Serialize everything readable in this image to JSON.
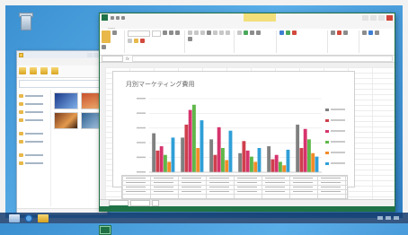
{
  "desktop": {
    "icons": [
      {
        "icon": "recycle-bin-icon"
      }
    ]
  },
  "explorer": {
    "tabs": [
      {
        "label": ""
      },
      {
        "label": ""
      },
      {
        "label": ""
      },
      {
        "label": ""
      }
    ],
    "nav_items": [
      {
        "icon": "folder-icon"
      },
      {
        "icon": "folder-icon"
      },
      {
        "icon": "folder-icon"
      },
      {
        "icon": "folder-icon"
      },
      {
        "icon": "folder-icon"
      },
      {
        "icon": "folder-icon"
      },
      {
        "icon": "folder-icon"
      },
      {
        "icon": "folder-icon"
      }
    ],
    "files": [
      {
        "icon": "image-thumbnail"
      },
      {
        "icon": "image-thumbnail"
      },
      {
        "icon": "image-thumbnail"
      },
      {
        "icon": "image-thumbnail"
      }
    ]
  },
  "excel": {
    "app_icon": "excel-icon",
    "ribbon_tabs": [
      {
        "label": ""
      },
      {
        "label": ""
      },
      {
        "label": ""
      },
      {
        "label": ""
      },
      {
        "label": ""
      },
      {
        "label": ""
      },
      {
        "label": ""
      },
      {
        "label": ""
      }
    ],
    "chart_title": "月別マーケティング費用"
  },
  "colors": {
    "excel_green": "#1f7246",
    "series_gray": "#808080",
    "series_red": "#cf3f4c",
    "series_pink": "#d6336c",
    "series_green": "#5fb84a",
    "series_orange": "#f28c28",
    "series_blue": "#2f9fd8"
  },
  "chart_data": {
    "type": "bar",
    "categories": [
      "",
      "",
      "",
      "",
      "",
      ""
    ],
    "series": [
      {
        "values": [
          45,
          40,
          38,
          22,
          30,
          55
        ],
        "color": "#808080"
      },
      {
        "values": [
          25,
          55,
          20,
          36,
          15,
          28
        ],
        "color": "#cf3f4c"
      },
      {
        "values": [
          30,
          72,
          52,
          25,
          20,
          50
        ],
        "color": "#d6336c"
      },
      {
        "values": [
          20,
          78,
          28,
          18,
          12,
          38
        ],
        "color": "#5fb84a"
      },
      {
        "values": [
          12,
          28,
          14,
          12,
          8,
          22
        ],
        "color": "#f28c28"
      },
      {
        "values": [
          40,
          60,
          48,
          28,
          26,
          18
        ],
        "color": "#2f9fd8"
      }
    ],
    "ylim": [
      0,
      85
    ],
    "grid": true,
    "legend": "right"
  }
}
